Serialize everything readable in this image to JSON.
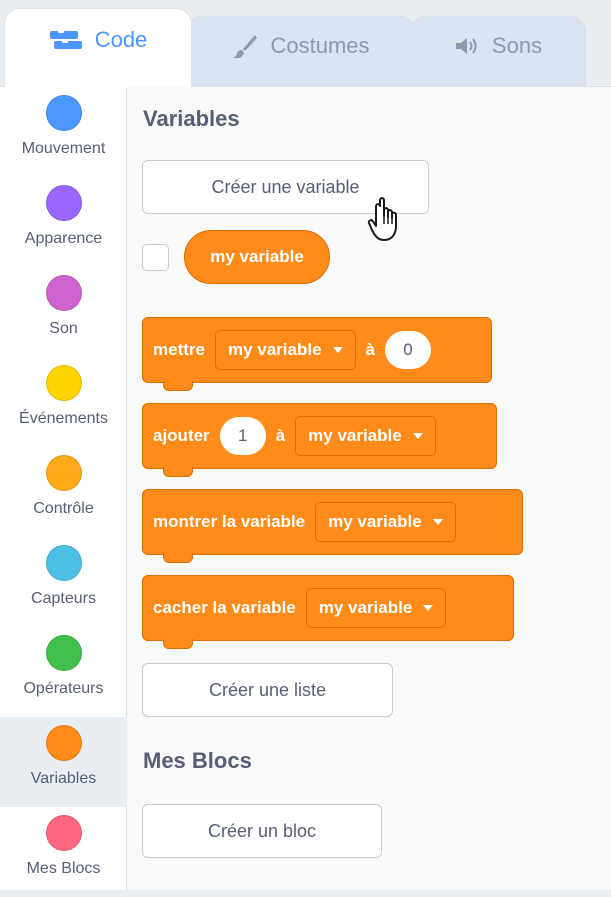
{
  "tabs": {
    "code": "Code",
    "costumes": "Costumes",
    "sons": "Sons"
  },
  "categories": [
    {
      "label": "Mouvement",
      "color": "#4c97ff"
    },
    {
      "label": "Apparence",
      "color": "#9966ff"
    },
    {
      "label": "Son",
      "color": "#cf63cf"
    },
    {
      "label": "Événements",
      "color": "#ffd500"
    },
    {
      "label": "Contrôle",
      "color": "#ffab19"
    },
    {
      "label": "Capteurs",
      "color": "#4cbfe6"
    },
    {
      "label": "Opérateurs",
      "color": "#40bf4a"
    },
    {
      "label": "Variables",
      "color": "#ff8c1a"
    },
    {
      "label": "Mes Blocs",
      "color": "#ff6680"
    }
  ],
  "selected_category": "Variables",
  "palette": {
    "variables_heading": "Variables",
    "create_variable": "Créer une variable",
    "variable_name": "my variable",
    "blocks": {
      "set": {
        "text": "mettre",
        "dropdown": "my variable",
        "to": "à",
        "value": "0"
      },
      "change": {
        "text": "ajouter",
        "value": "1",
        "to": "à",
        "dropdown": "my variable"
      },
      "show": {
        "text": "montrer la variable",
        "dropdown": "my variable"
      },
      "hide": {
        "text": "cacher la variable",
        "dropdown": "my variable"
      }
    },
    "create_list": "Créer une liste",
    "myblocks_heading": "Mes Blocs",
    "create_block": "Créer un bloc"
  },
  "colors": {
    "accent": "#4c97ff",
    "variables": "#ff8c1a",
    "variables_border": "#db6e00"
  }
}
